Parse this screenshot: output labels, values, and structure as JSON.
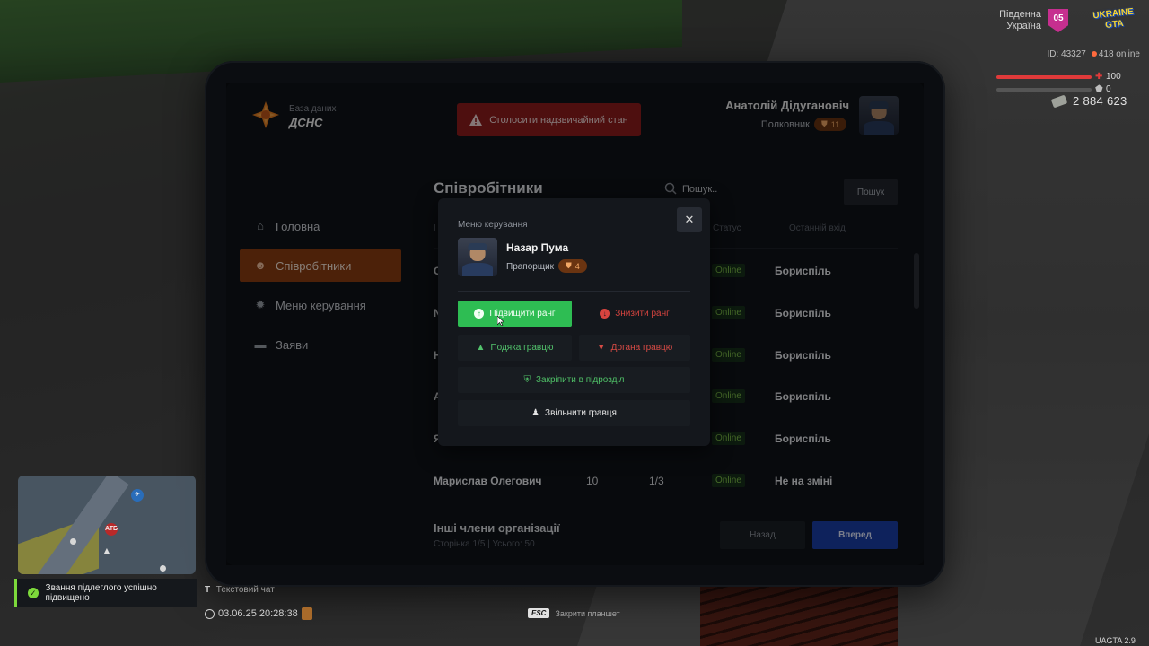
{
  "hud": {
    "server_name": "Південна Україна",
    "server_number": "05",
    "game_logo": "UKRAINE GTA",
    "player_id": "ID: 43327",
    "online": "418 online",
    "health": "100",
    "armor": "0",
    "money": "2 884 623",
    "version": "UAGTA 2.9"
  },
  "brand": {
    "subtitle": "База даних",
    "name": "ДСНС"
  },
  "emergency_button": "Оголосити надзвичайний стан",
  "user": {
    "name": "Анатолій Дідугановіч",
    "rank": "Полковник",
    "level": "11"
  },
  "sidebar": {
    "items": [
      {
        "label": "Головна",
        "icon": "home-icon"
      },
      {
        "label": "Співробітники",
        "icon": "users-icon",
        "active": true
      },
      {
        "label": "Меню керування",
        "icon": "gear-icon"
      },
      {
        "label": "Заяви",
        "icon": "folder-icon"
      }
    ]
  },
  "main": {
    "title": "Співробітники",
    "search_placeholder": "Пошук..",
    "search_button": "Пошук",
    "columns": {
      "id": "І",
      "status": "Статус",
      "last_login": "Останній вхід"
    },
    "rows": [
      {
        "name_initial": "С",
        "status": "Online",
        "location": "Бориспіль"
      },
      {
        "name_initial": "N",
        "status": "Online",
        "location": "Бориспіль"
      },
      {
        "name_initial": "Н",
        "status": "Online",
        "location": "Бориспіль"
      },
      {
        "name_initial": "А",
        "status": "Online",
        "location": "Бориспіль"
      },
      {
        "name_initial": "Я",
        "status": "Online",
        "location": "Бориспіль"
      },
      {
        "name": "Марислав Олегович",
        "rank": "10",
        "warns": "1/3",
        "status": "Online",
        "location": "Не на зміні"
      }
    ],
    "other_title": "Інші члени організації",
    "pagination": "Сторінка 1/5 | Усього: 50",
    "back_button": "Назад",
    "next_button": "Вперед"
  },
  "modal": {
    "title": "Меню керування",
    "employee": {
      "name": "Назар Пума",
      "rank": "Прапорщик",
      "level": "4"
    },
    "actions": {
      "promote": "Підвищити ранг",
      "demote": "Знизити ранг",
      "thanks": "Подяка гравцю",
      "reprimand": "Догана гравцю",
      "assign": "Закріпити в підрозділ",
      "fire": "Звільнити гравця"
    }
  },
  "notification": "Звання підлеглого успішно підвищено",
  "chat": {
    "key": "Т",
    "label": "Текстовий чат"
  },
  "datetime": "03.06.25 20:28:38",
  "esc_hint": {
    "key": "ESC",
    "label": "Закрити планшет"
  },
  "minimap": {
    "atb_label": "АТБ"
  },
  "colors": {
    "accent_orange": "#8a3d12",
    "emergency_red": "#8f1d1d",
    "promote_green": "#2ebd53",
    "next_blue": "#1b3fa8"
  }
}
